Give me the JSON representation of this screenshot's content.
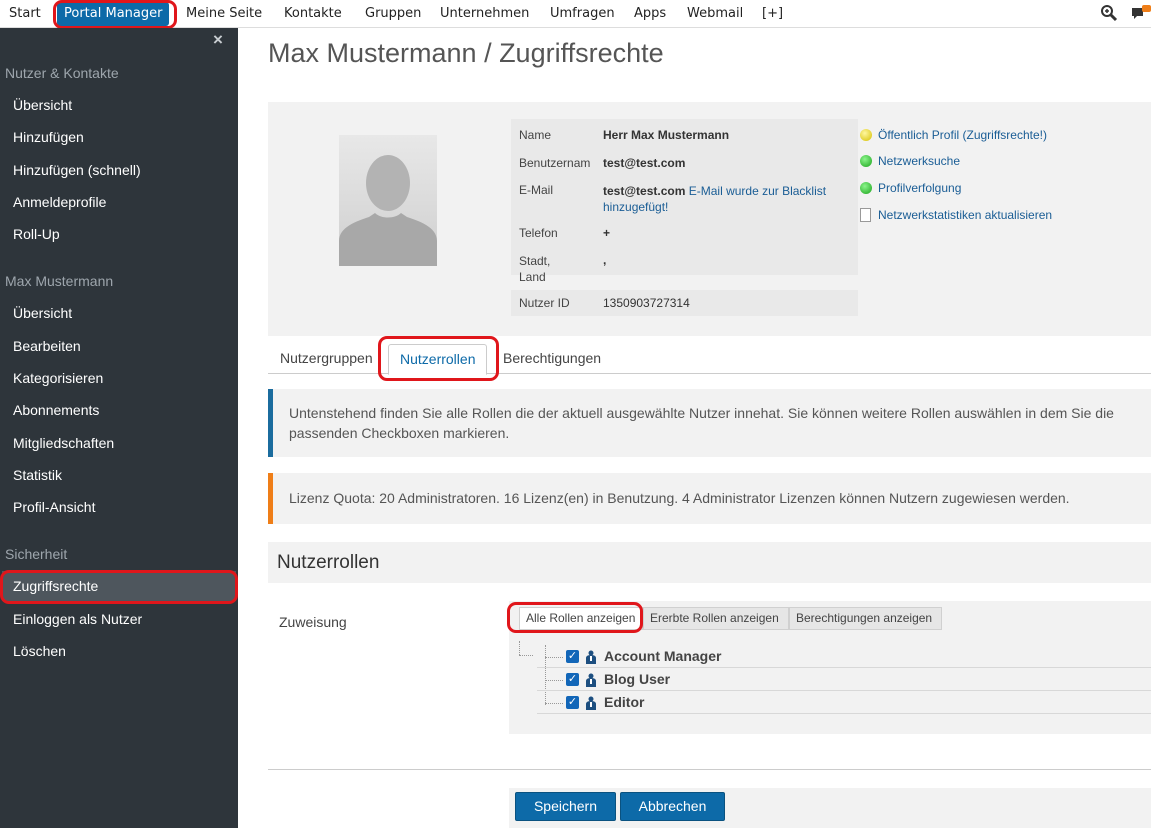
{
  "topnav": {
    "items": [
      "Start",
      "Portal Manager",
      "Meine Seite",
      "Kontakte",
      "Gruppen",
      "Unternehmen",
      "Umfragen",
      "Apps",
      "Webmail",
      "[+]"
    ],
    "active": "Portal Manager",
    "icons": [
      "search-icon",
      "chat-icon"
    ],
    "accent": "#0d6aa8",
    "highlight": "#e0161b"
  },
  "sidebar": {
    "close_glyph": "×",
    "sections": [
      {
        "title": "Nutzer & Kontakte",
        "items": [
          "Übersicht",
          "Hinzufügen",
          "Hinzufügen (schnell)",
          "Anmeldeprofile",
          "Roll-Up"
        ]
      },
      {
        "title": "Max Mustermann",
        "items": [
          "Übersicht",
          "Bearbeiten",
          "Kategorisieren",
          "Abonnements",
          "Mitgliedschaften",
          "Statistik",
          "Profil-Ansicht"
        ]
      },
      {
        "title": "Sicherheit",
        "items": [
          "Zugriffsrechte",
          "Einloggen als Nutzer",
          "Löschen"
        ]
      }
    ],
    "active_item": "Zugriffsrechte",
    "bg": "#2e353b"
  },
  "page": {
    "title": "Max Mustermann / Zugriffsrechte"
  },
  "profile": {
    "fields": [
      {
        "label": "Name",
        "value": "Herr Max Mustermann"
      },
      {
        "label": "Benutzernam",
        "value": "test@test.com"
      },
      {
        "label": "E-Mail",
        "value": "test@test.com",
        "note": "E-Mail wurde zur Blacklist hinzugefügt!"
      },
      {
        "label": "Telefon",
        "value": "+"
      },
      {
        "label": "Stadt, Land",
        "value": ","
      },
      {
        "label": "Nutzer ID",
        "value": "1350903727314"
      }
    ],
    "status_links": [
      {
        "icon": "yellow-status-icon",
        "text": "Öffentlich Profil",
        "extra": "(Zugriffsrechte!)"
      },
      {
        "icon": "green-status-icon",
        "text": "Netzwerksuche"
      },
      {
        "icon": "green-status-icon",
        "text": "Profilverfolgung"
      },
      {
        "icon": "document-icon",
        "text": "Netzwerkstatistiken aktualisieren"
      }
    ]
  },
  "tabs": [
    "Nutzergruppen",
    "Nutzerrollen",
    "Berechtigungen"
  ],
  "active_tab": "Nutzerrollen",
  "alerts": {
    "info": "Untenstehend finden Sie alle Rollen die der aktuell ausgewählte Nutzer innehat. Sie können weitere Rollen auswählen in dem Sie die passenden Checkboxen markieren.",
    "warn": "Lizenz Quota: 20 Administratoren. 16 Lizenz(en) in Benutzung. 4 Administrator Lizenzen können Nutzern zugewiesen werden.",
    "info_color": "#1b6c9e",
    "warn_color": "#ef7e18"
  },
  "roles": {
    "header": "Nutzerrollen",
    "assign_label": "Zuweisung",
    "filter_buttons": [
      "Alle Rollen anzeigen",
      "Ererbte Rollen anzeigen",
      "Berechtigungen anzeigen"
    ],
    "active_filter": "Alle Rollen anzeigen",
    "items": [
      {
        "name": "Account Manager",
        "checked": true
      },
      {
        "name": "Blog User",
        "checked": true
      },
      {
        "name": "Editor",
        "checked": true
      }
    ]
  },
  "actions": {
    "save": "Speichern",
    "cancel": "Abbrechen"
  }
}
